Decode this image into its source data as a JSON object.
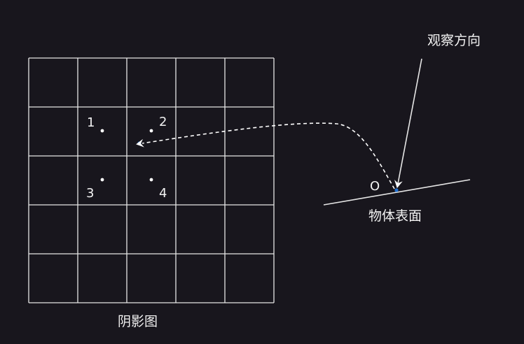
{
  "colors": {
    "background": "#18161d",
    "stroke": "#e6e6e6",
    "accent_point": "#1f6fd1",
    "text": "#f2f2f2"
  },
  "shadow_map": {
    "caption": "阴影图",
    "rows": 5,
    "cols": 5,
    "sample_labels": [
      "1",
      "2",
      "3",
      "4"
    ]
  },
  "surface": {
    "caption": "物体表面",
    "point_label": "O"
  },
  "view_direction": {
    "label": "观察方向"
  }
}
